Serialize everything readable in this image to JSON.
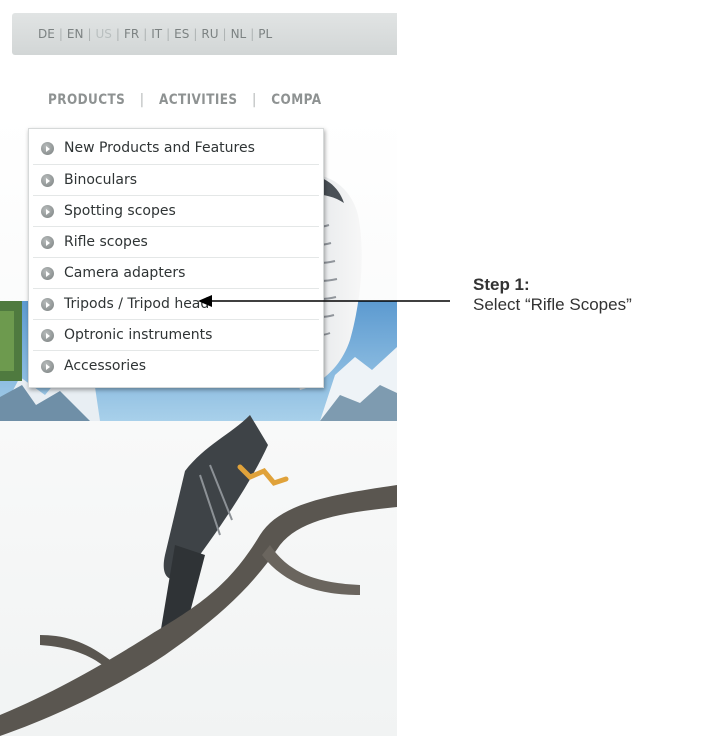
{
  "language_bar": {
    "languages": [
      "DE",
      "EN",
      "US",
      "FR",
      "IT",
      "ES",
      "RU",
      "NL",
      "PL"
    ],
    "active": "US"
  },
  "main_nav": {
    "items": [
      "PRODUCTS",
      "ACTIVITIES",
      "COMPA"
    ]
  },
  "dropdown": {
    "items": [
      {
        "label": "New Products and Features"
      },
      {
        "label": "Binoculars"
      },
      {
        "label": "Spotting scopes"
      },
      {
        "label": "Rifle scopes"
      },
      {
        "label": "Camera adapters"
      },
      {
        "label": "Tripods / Tripod head"
      },
      {
        "label": "Optronic instruments"
      },
      {
        "label": "Accessories"
      }
    ]
  },
  "annotation": {
    "title": "Step 1:",
    "text": "Select “Rifle Scopes”"
  },
  "colors": {
    "language_bar_bg": "#d9dcdc",
    "nav_text": "#8e9292",
    "menu_text": "#2f3435",
    "annotation_text": "#333333"
  }
}
